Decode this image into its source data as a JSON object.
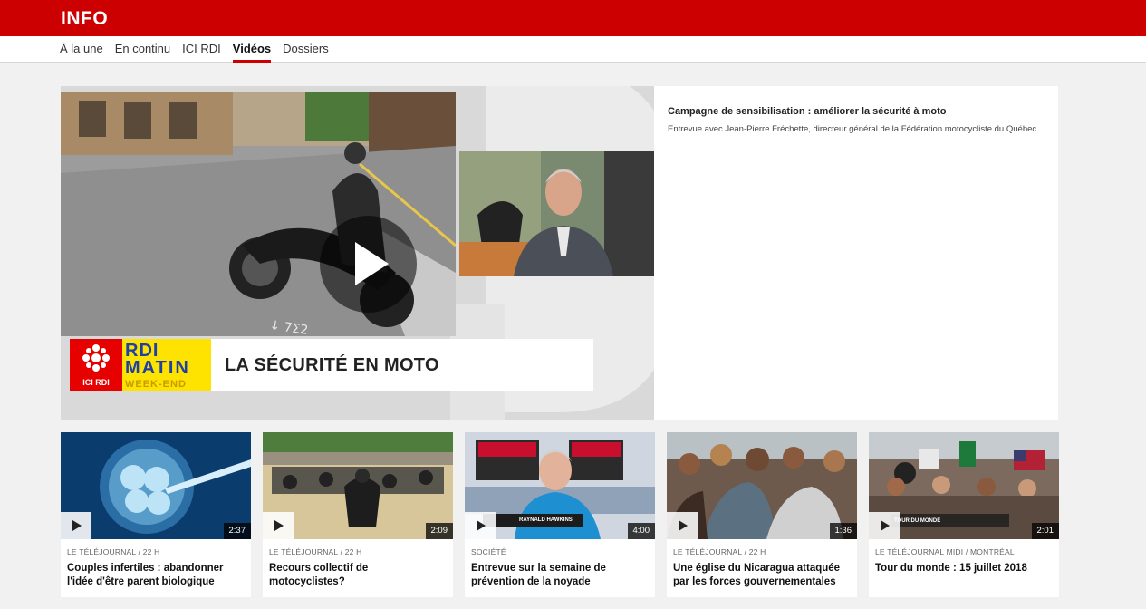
{
  "header": {
    "brand": "INFO"
  },
  "nav": [
    {
      "label": "À la une",
      "active": false
    },
    {
      "label": "En continu",
      "active": false
    },
    {
      "label": "ICI RDI",
      "active": false
    },
    {
      "label": "Vidéos",
      "active": true
    },
    {
      "label": "Dossiers",
      "active": false
    }
  ],
  "feature": {
    "headline": "Campagne de sensibilisation : améliorer la sécurité à moto",
    "description": "Entrevue avec Jean-Pierre Fréchette, directeur général de la Fédération motocycliste du Québec",
    "lower_third": {
      "title": "LA SÉCURITÉ EN MOTO",
      "channel_logo": "ICI RDI",
      "show_logo_lines": [
        "RDI",
        "MATIN",
        "WEEK-END"
      ]
    }
  },
  "cards": [
    {
      "category": "LE TÉLÉJOURNAL / 22 H",
      "title": "Couples infertiles : abandonner l'idée d'être parent biologique",
      "duration": "2:37",
      "thumb_tag": ""
    },
    {
      "category": "LE TÉLÉJOURNAL / 22 H",
      "title": "Recours collectif de motocyclistes?",
      "duration": "2:09",
      "thumb_tag": ""
    },
    {
      "category": "SOCIÉTÉ",
      "title": "Entrevue sur la semaine de prévention de la noyade",
      "duration": "4:00",
      "thumb_tag": "RAYNALD HAWKINS"
    },
    {
      "category": "LE TÉLÉJOURNAL / 22 H",
      "title": "Une église du Nicaragua attaquée par les forces gouvernementales",
      "duration": "1:36",
      "thumb_tag": ""
    },
    {
      "category": "LE TÉLÉJOURNAL MIDI / MONTRÉAL",
      "title": "Tour du monde : 15 juillet 2018",
      "duration": "2:01",
      "thumb_tag": "TOUR DU MONDE"
    }
  ],
  "colors": {
    "brand_red": "#cc0000",
    "background": "#f1f1f1"
  }
}
